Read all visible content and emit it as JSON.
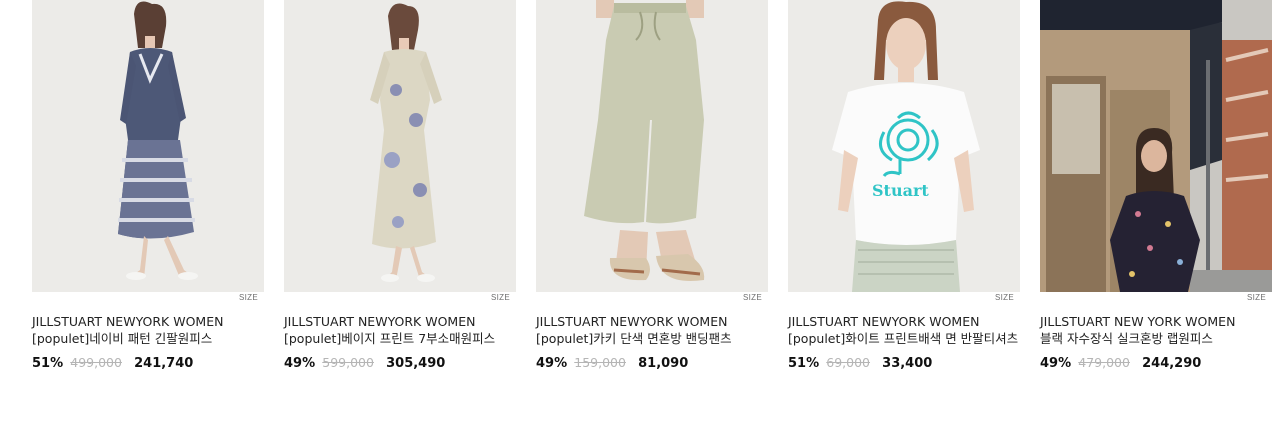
{
  "products": [
    {
      "size_tag": "SIZE",
      "brand": "JILLSTUART NEWYORK WOMEN",
      "name": "[populet]네이비 패턴 긴팔원피스",
      "discount": "51%",
      "original_price": "499,000",
      "sale_price": "241,740",
      "image_desc": "navy-patterned-long-sleeve-dress"
    },
    {
      "size_tag": "SIZE",
      "brand": "JILLSTUART NEWYORK WOMEN",
      "name": "[populet]베이지 프린트 7부소매원피스",
      "discount": "49%",
      "original_price": "599,000",
      "sale_price": "305,490",
      "image_desc": "beige-print-dress"
    },
    {
      "size_tag": "SIZE",
      "brand": "JILLSTUART NEWYORK WOMEN",
      "name": "[populet]카키 단색 면혼방 밴딩팬츠",
      "discount": "49%",
      "original_price": "159,000",
      "sale_price": "81,090",
      "image_desc": "khaki-wide-pants"
    },
    {
      "size_tag": "SIZE",
      "brand": "JILLSTUART NEWYORK WOMEN",
      "name": "[populet]화이트 프린트배색 면 반팔티셔츠",
      "discount": "51%",
      "original_price": "69,000",
      "sale_price": "33,400",
      "image_desc": "white-print-tshirt"
    },
    {
      "size_tag": "SIZE",
      "brand": "JILLSTUART NEW YORK WOMEN",
      "name": "블랙 자수장식 실크혼방 랩원피스",
      "discount": "49%",
      "original_price": "479,000",
      "sale_price": "244,290",
      "image_desc": "black-embroidered-wrap-dress"
    }
  ]
}
